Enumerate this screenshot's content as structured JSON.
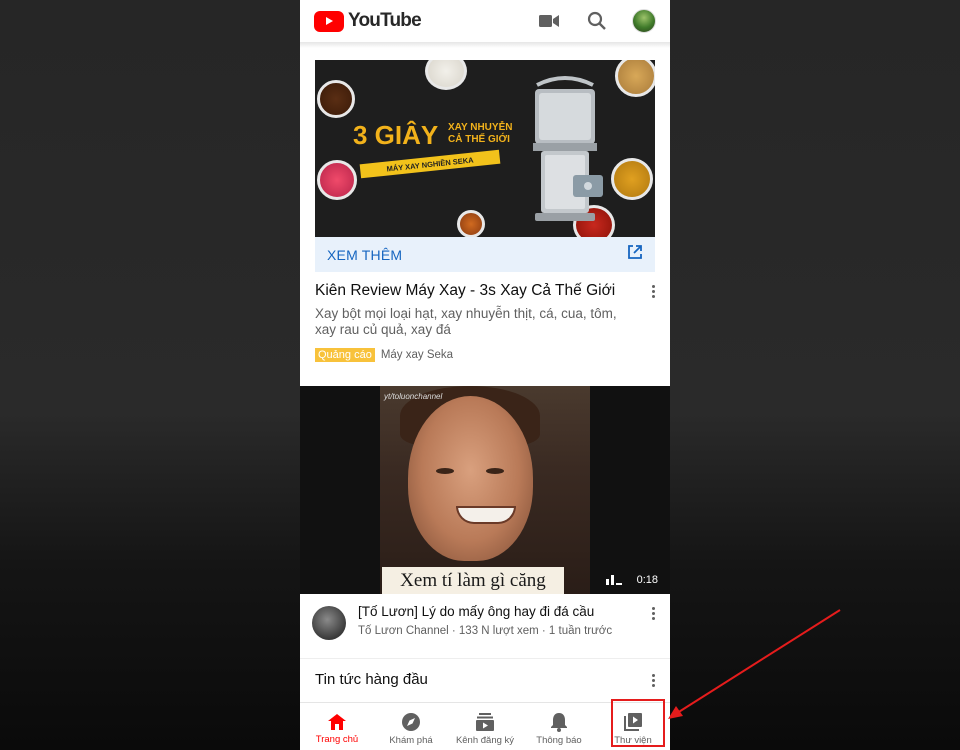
{
  "header": {
    "logo_text": "YouTube",
    "icons": [
      "camera-icon",
      "search-icon",
      "account-avatar"
    ]
  },
  "ad": {
    "image": {
      "headline_big": "3 GIÂY",
      "headline_small_line1": "XAY NHUYỄN",
      "headline_small_line2": "CẢ THẾ GIỚI",
      "strip_text": "MÁY XAY NGHIỀN SEKA"
    },
    "cta_label": "XEM THÊM",
    "title": "Kiên Review Máy Xay - 3s Xay Cả Thế Giới",
    "description": "Xay bột mọi loại hạt, xay nhuyễn thịt, cá, cua, tôm, xay rau củ quả, xay đá",
    "badge": "Quảng cáo",
    "advertiser": "Máy xay Seka"
  },
  "video": {
    "watermark": "yt/toluonchannel",
    "caption": "Xem tí làm gì căng",
    "duration": "0:18",
    "title": "[Tố Lươn] Lý do mấy ông hay đi đá cầu",
    "meta": "Tố Lươn Channel · 133 N lượt xem · 1 tuần trước"
  },
  "news": {
    "title": "Tin tức hàng đầu"
  },
  "bottom_nav": {
    "items": [
      {
        "label": "Trang chủ",
        "icon": "home-icon",
        "active": true
      },
      {
        "label": "Khám phá",
        "icon": "compass-icon",
        "active": false
      },
      {
        "label": "Kênh đăng ký",
        "icon": "subscriptions-icon",
        "active": false
      },
      {
        "label": "Thông báo",
        "icon": "bell-icon",
        "active": false
      },
      {
        "label": "Thư viện",
        "icon": "library-icon",
        "active": false
      }
    ]
  },
  "colors": {
    "brand_red": "#ff0000",
    "link_blue": "#1565c0",
    "ad_badge": "#f8c23b",
    "annotation_red": "#e51c1c"
  }
}
